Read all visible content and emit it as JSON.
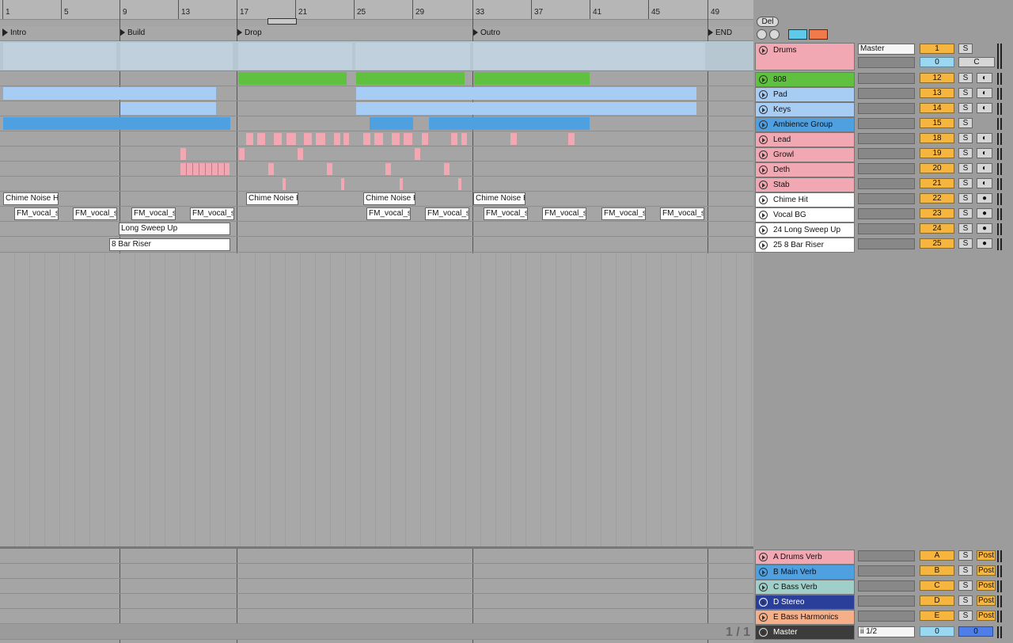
{
  "ruler": [
    "1",
    "5",
    "9",
    "13",
    "17",
    "21",
    "25",
    "29",
    "33",
    "37",
    "41",
    "45",
    "49"
  ],
  "locators": [
    "Intro",
    "Build",
    "Drop",
    "Outro",
    "END"
  ],
  "clips": {
    "chime": "Chime Noise H",
    "fm": "FM_vocal_s",
    "sweep": "Long Sweep Up",
    "riser": "8 Bar Riser"
  },
  "top_controls": {
    "del": "Del"
  },
  "tracks": [
    {
      "name": "Drums",
      "num": "1",
      "color": "#f2a8b2"
    },
    {
      "name": "808",
      "num": "12",
      "color": "#5fc13f"
    },
    {
      "name": "Pad",
      "num": "13",
      "color": "#a8cdf5"
    },
    {
      "name": "Keys",
      "num": "14",
      "color": "#a8cdf5"
    },
    {
      "name": "Ambience Group",
      "num": "15",
      "color": "#4fa0e0"
    },
    {
      "name": "Lead",
      "num": "18",
      "color": "#f2a8b2"
    },
    {
      "name": "Growl",
      "num": "19",
      "color": "#f2a8b2"
    },
    {
      "name": "Deth",
      "num": "20",
      "color": "#f2a8b2"
    },
    {
      "name": "Stab",
      "num": "21",
      "color": "#f2a8b2"
    },
    {
      "name": "Chime Hit",
      "num": "22",
      "color": "#ffffff"
    },
    {
      "name": "Vocal BG",
      "num": "23",
      "color": "#ffffff"
    },
    {
      "name": "24 Long Sweep Up",
      "num": "24",
      "color": "#ffffff"
    },
    {
      "name": "25 8 Bar Riser",
      "num": "25",
      "color": "#ffffff"
    }
  ],
  "drums_extra": {
    "route": "Master",
    "num2": "0",
    "c": "C",
    "s": "S"
  },
  "returns": [
    {
      "name": "A Drums Verb",
      "num": "A",
      "color": "#f2a8b2"
    },
    {
      "name": "B Main Verb",
      "num": "B",
      "color": "#4fa0e0"
    },
    {
      "name": "C Bass Verb",
      "num": "C",
      "color": "#9fcfc8"
    },
    {
      "name": "D Stereo",
      "num": "D",
      "color": "#2a3f9a"
    },
    {
      "name": "E Bass Harmonics",
      "num": "E",
      "color": "#f5b08a"
    }
  ],
  "master": {
    "name": "Master",
    "route": "ii 1/2",
    "num": "0",
    "num2": "0"
  },
  "labels": {
    "s": "S",
    "post": "Post"
  },
  "page_indicator": "1 / 1"
}
